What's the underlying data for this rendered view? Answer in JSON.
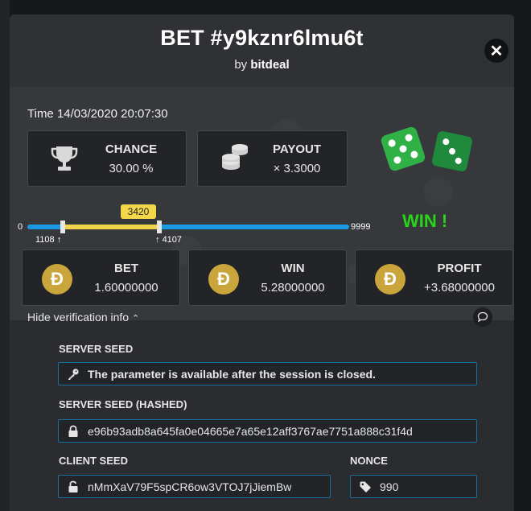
{
  "modal": {
    "title": "BET #y9kznr6lmu6t",
    "by_prefix": "by",
    "author": "bitdeal",
    "close_symbol": "✕"
  },
  "result": {
    "time": "Time 14/03/2020 20:07:30",
    "chance": {
      "label": "CHANCE",
      "value": "30.00 %"
    },
    "payout": {
      "label": "PAYOUT",
      "value": "× 3.3000"
    },
    "status": "WIN !",
    "range": {
      "min": "0",
      "max": "9999",
      "low": "1108",
      "high": "4107",
      "roll": "3420",
      "low_fraction": 0.111,
      "high_fraction": 0.411,
      "roll_fraction": 0.342
    },
    "bet": {
      "label": "BET",
      "value": "1.60000000",
      "currency_symbol": "Đ"
    },
    "win": {
      "label": "WIN",
      "value": "5.28000000",
      "currency_symbol": "Đ"
    },
    "profit": {
      "label": "PROFIT",
      "value": "+3.68000000",
      "currency_symbol": "Đ"
    }
  },
  "verification": {
    "toggle_label": "Hide verification info",
    "server_seed": {
      "label": "SERVER SEED",
      "value": "The parameter is available after the session is closed.",
      "icon": "key-icon"
    },
    "server_seed_hashed": {
      "label": "SERVER SEED (HASHED)",
      "value": "e96b93adb8a645fa0e04665e7a65e12aff3767ae7751a888c31f4d",
      "icon": "lock-icon"
    },
    "client_seed": {
      "label": "CLIENT SEED",
      "value": "nMmXaV79F5spCR6ow3VTOJ7jJiemBw",
      "icon": "unlock-icon"
    },
    "nonce": {
      "label": "NONCE",
      "value": "990",
      "icon": "tag-icon"
    }
  },
  "colors": {
    "accent_blue": "#1a9ae5",
    "accent_yellow": "#f0d548",
    "win_green": "#29d51a",
    "coin_gold": "#c9a53b"
  }
}
